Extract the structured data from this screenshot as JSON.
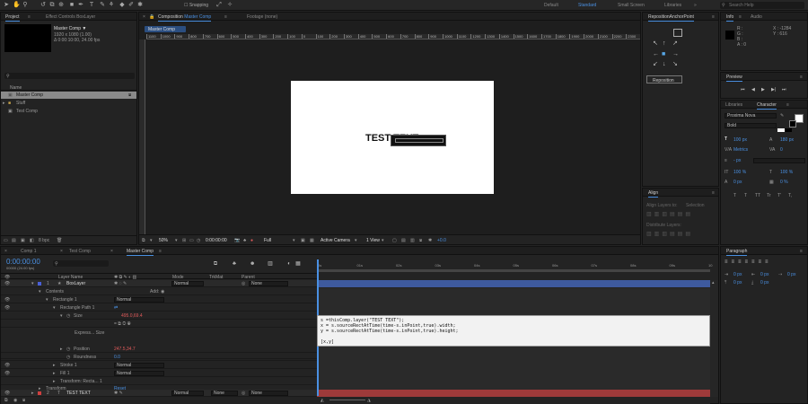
{
  "toolbar": {
    "snapping": "Snapping",
    "workspaces": [
      "Default",
      "Standard",
      "Small Screen",
      "Libraries"
    ],
    "active_ws": "Standard",
    "search_placeholder": "Search Help"
  },
  "project": {
    "tab": "Project",
    "effect_tab": "Effect Controls BoxLayer",
    "comp_name": "Master Comp ▼",
    "comp_size": "1920 x 1080 (1.00)",
    "comp_dur": "Δ 0:00:10:00, 24.00 fps",
    "col_name": "Name",
    "items": [
      "Master Comp",
      "Stuff",
      "Test Comp"
    ],
    "bpc": "8 bpc"
  },
  "comp": {
    "tab_label": "Composition",
    "tab_comp": "Master Comp",
    "footage_tab": "Footage (none)",
    "breadcrumb": "Master Comp",
    "ruler": [
      "1100",
      "1000",
      "900",
      "800",
      "700",
      "600",
      "500",
      "400",
      "300",
      "200",
      "100",
      "0",
      "100",
      "200",
      "300",
      "400",
      "500",
      "600",
      "700",
      "800",
      "900",
      "1000",
      "1100",
      "1200",
      "1300",
      "1400",
      "1500",
      "1600",
      "1700",
      "1800",
      "1900",
      "2000",
      "2100",
      "2200",
      "2300"
    ],
    "text": "TEST TEXT",
    "zoom": "50%",
    "timecode": "0:00:00:00",
    "quality": "Full",
    "camera": "Active Camera",
    "view": "1 View",
    "offset": "+0.0"
  },
  "anchor": {
    "title": "RepositionAnchorPoint",
    "button": "Reposition"
  },
  "info": {
    "tab": "Info",
    "audio_tab": "Audio",
    "r": "R :",
    "g": "G :",
    "b": "B :",
    "a": "A : 0",
    "x": "X : -1284",
    "y": "Y : 616"
  },
  "preview": {
    "title": "Preview"
  },
  "character": {
    "lib_tab": "Libraries",
    "tab": "Character",
    "font": "Proxima Nova",
    "style": "Bold",
    "size": "100 px",
    "leading": "180 px",
    "tracking": "0",
    "auto": "Metrics",
    "kern": "0",
    "stroke": "- px",
    "scale_v": "100 %",
    "scale_h": "100 %",
    "baseline": "0 px",
    "tsume": "0 %",
    "type_buttons": [
      "T",
      "T",
      "TT",
      "Tr",
      "T'",
      "T,"
    ]
  },
  "align": {
    "title": "Align",
    "layers_to": "Align Layers to:",
    "selection": "Selection",
    "distribute": "Distribute Layers:"
  },
  "paragraph": {
    "title": "Paragraph",
    "indent": [
      "0 px",
      "0 px",
      "0 px",
      "0 px",
      "0 px"
    ]
  },
  "timeline": {
    "tabs": [
      "Comp 1",
      "Test Comp",
      "Master Comp"
    ],
    "timecode": "0:00:00:00",
    "fps": "00000 (24.00 fps)",
    "cols": [
      "Layer Name",
      "Mode",
      "TrkMat",
      "Parent"
    ],
    "ruler": [
      "0s",
      "01s",
      "02s",
      "03s",
      "04s",
      "05s",
      "06s",
      "07s",
      "08s",
      "09s",
      "10"
    ],
    "rows": [
      {
        "num": "1",
        "name": "BoxLayer",
        "mode": "Normal",
        "parent": "None"
      },
      {
        "name": "Contents",
        "add": "Add:"
      },
      {
        "name": "Rectangle 1",
        "mode": "Normal"
      },
      {
        "name": "Rectangle Path 1"
      },
      {
        "name": "Size",
        "value": "495.0,69.4"
      },
      {
        "name": "Express... Size"
      },
      {
        "name": "Position",
        "value": "247.5,34.7"
      },
      {
        "name": "Roundness",
        "value": "0.0"
      },
      {
        "name": "Stroke 1",
        "mode": "Normal"
      },
      {
        "name": "Fill 1",
        "mode": "Normal"
      },
      {
        "name": "Transform: Recta... 1"
      },
      {
        "name": "Transform",
        "value": "Reset"
      },
      {
        "num": "2",
        "name": "TEST TEXT",
        "mode": "Normal",
        "trk": "None",
        "parent": "None"
      }
    ],
    "expression": [
      "s =thisComp.layer(\"TEST TEXT\");",
      "x = s.sourceRectAtTime(time-s.inPoint,true).width;",
      "y = s.sourceRectAtTime(time-s.inPoint,true).height;",
      "",
      "[x,y]"
    ]
  }
}
